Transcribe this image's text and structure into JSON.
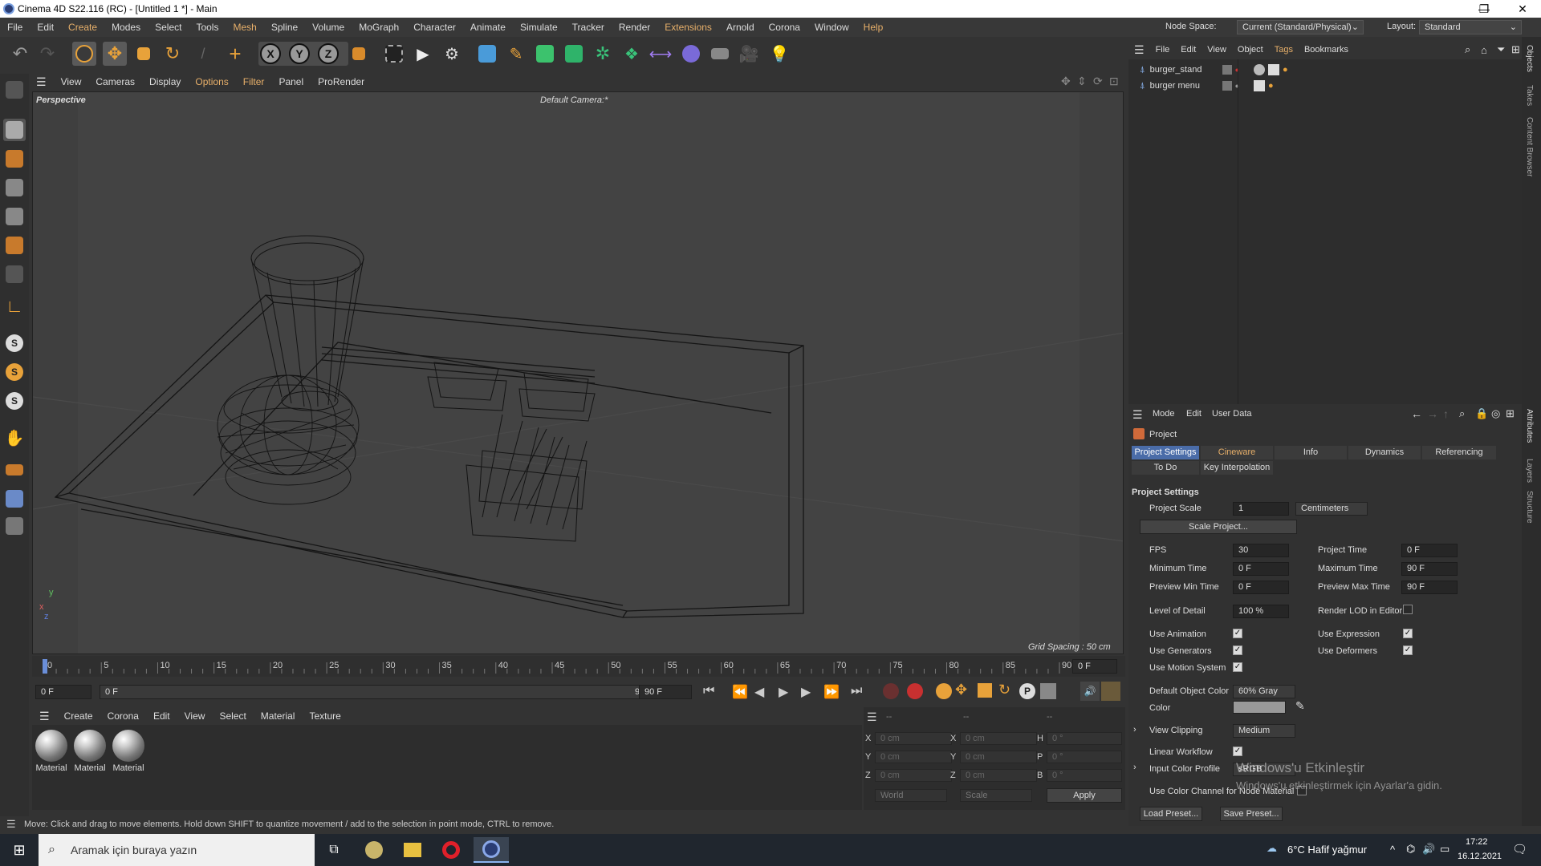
{
  "window": {
    "title": "Cinema 4D S22.116 (RC) - [Untitled 1 *] - Main",
    "minimize": "—",
    "restore": "❐",
    "close": "✕"
  },
  "menubar": {
    "items": [
      "File",
      "Edit",
      "Create",
      "Modes",
      "Select",
      "Tools",
      "Mesh",
      "Spline",
      "Volume",
      "MoGraph",
      "Character",
      "Animate",
      "Simulate",
      "Tracker",
      "Render",
      "Extensions",
      "Arnold",
      "Corona",
      "Window",
      "Help"
    ],
    "node_space_label": "Node Space:",
    "node_space_value": "Current (Standard/Physical)",
    "layout_label": "Layout:",
    "layout_value": "Standard"
  },
  "viewport": {
    "menu": [
      "View",
      "Cameras",
      "Display",
      "Options",
      "Filter",
      "Panel",
      "ProRender"
    ],
    "view_name": "Perspective",
    "camera": "Default Camera",
    "camera_mark": ":*",
    "grid_spacing": "Grid Spacing : 50 cm",
    "axis_x": "x",
    "axis_y": "y",
    "axis_z": "z"
  },
  "timeline": {
    "ticks": [
      "0",
      "5",
      "10",
      "15",
      "20",
      "25",
      "30",
      "35",
      "40",
      "45",
      "50",
      "55",
      "60",
      "65",
      "70",
      "75",
      "80",
      "85",
      "90"
    ],
    "current_frame": "0 F",
    "start_field": "0 F",
    "range_start": "0 F",
    "range_end": "90 F",
    "end_field": "90 F"
  },
  "material_manager": {
    "menu": [
      "Create",
      "Corona",
      "Edit",
      "View",
      "Select",
      "Material",
      "Texture"
    ],
    "materials": [
      "Material",
      "Material",
      "Material"
    ]
  },
  "coordinates": {
    "headers": [
      "--",
      "--",
      "--"
    ],
    "rows": [
      {
        "a": "X",
        "av": "0 cm",
        "b": "X",
        "bv": "0 cm",
        "c": "H",
        "cv": "0 °"
      },
      {
        "a": "Y",
        "av": "0 cm",
        "b": "Y",
        "bv": "0 cm",
        "c": "P",
        "cv": "0 °"
      },
      {
        "a": "Z",
        "av": "0 cm",
        "b": "Z",
        "bv": "0 cm",
        "c": "B",
        "cv": "0 °"
      }
    ],
    "space": "World",
    "mode": "Scale",
    "apply": "Apply"
  },
  "status_text": "Move: Click and drag to move elements. Hold down SHIFT to quantize movement / add to the selection in point mode, CTRL to remove.",
  "object_manager": {
    "menu": [
      "File",
      "Edit",
      "View",
      "Object",
      "Tags",
      "Bookmarks"
    ],
    "objects": [
      "burger_stand",
      "burger menu"
    ]
  },
  "side_tabs": [
    "Objects",
    "Takes",
    "Content Browser",
    "Attributes",
    "Layers",
    "Structure"
  ],
  "attributes": {
    "menu": [
      "Mode",
      "Edit",
      "User Data"
    ],
    "object_name": "Project",
    "tabs": [
      "Project Settings",
      "Cineware",
      "Info",
      "Dynamics",
      "Referencing"
    ],
    "tabs2": [
      "To Do",
      "Key Interpolation"
    ],
    "section": "Project Settings",
    "project_scale_label": "Project Scale",
    "project_scale_value": "1",
    "project_scale_unit": "Centimeters",
    "scale_project_button": "Scale Project...",
    "fps_label": "FPS",
    "fps_value": "30",
    "project_time_label": "Project Time",
    "project_time_value": "0 F",
    "min_time_label": "Minimum Time",
    "min_time_value": "0 F",
    "max_time_label": "Maximum Time",
    "max_time_value": "90 F",
    "preview_min_label": "Preview Min Time",
    "preview_min_value": "0 F",
    "preview_max_label": "Preview Max Time",
    "preview_max_value": "90 F",
    "lod_label": "Level of Detail",
    "lod_value": "100 %",
    "render_lod_label": "Render LOD in Editor",
    "use_animation_label": "Use Animation",
    "use_expression_label": "Use Expression",
    "use_generators_label": "Use Generators",
    "use_deformers_label": "Use Deformers",
    "use_motion_label": "Use Motion System",
    "default_color_label": "Default Object Color",
    "default_color_value": "60% Gray",
    "color_label": "Color",
    "view_clipping_label": "View Clipping",
    "view_clipping_value": "Medium",
    "linear_workflow_label": "Linear Workflow",
    "input_profile_label": "Input Color Profile",
    "input_profile_value": "sRGB",
    "use_color_channel_label": "Use Color Channel for Node Material",
    "load_preset": "Load Preset...",
    "save_preset": "Save Preset...",
    "checkmark": "✓"
  },
  "watermark": {
    "line1": "Windows'u Etkinleştir",
    "line2": "Windows'u etkinleştirmek için Ayarlar'a gidin."
  },
  "taskbar": {
    "search_placeholder": "Aramak için buraya yazın",
    "weather": "6°C  Hafif yağmur",
    "time": "17:22",
    "date": "16.12.2021"
  },
  "colors": {
    "accent_blue": "#4a6ca8",
    "orange": "#e8b06a"
  }
}
